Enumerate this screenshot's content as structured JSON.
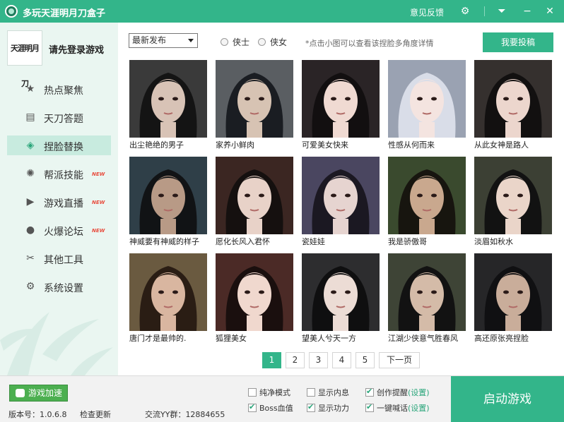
{
  "window": {
    "title": "多玩天涯明月刀盒子",
    "feedback": "意见反馈",
    "settings_icon": "⚙",
    "dropdown_icon": "⏷",
    "minimize_icon": "−",
    "close_icon": "✕"
  },
  "sidebar": {
    "avatar_text": "天涯明月刀",
    "login_label": "请先登录游戏",
    "items": [
      {
        "label": "热点聚焦",
        "icon": "★",
        "new": ""
      },
      {
        "label": "天刀答题",
        "icon": "▤",
        "new": ""
      },
      {
        "label": "捏脸替换",
        "icon": "◈",
        "new": ""
      },
      {
        "label": "帮派技能",
        "icon": "✺",
        "new": "NEW"
      },
      {
        "label": "游戏直播",
        "icon": "▶",
        "new": "NEW"
      },
      {
        "label": "火爆论坛",
        "icon": "●",
        "new": "NEW"
      },
      {
        "label": "其他工具",
        "icon": "✂",
        "new": ""
      },
      {
        "label": "系统设置",
        "icon": "⚙",
        "new": ""
      }
    ]
  },
  "toolbar": {
    "sort_value": "最新发布",
    "radio_male": "侠士",
    "radio_female": "侠女",
    "hint": "*点击小图可以查看该捏脸多角度详情",
    "submit_label": "我要投稿"
  },
  "faces": [
    {
      "caption": "出尘艳绝的男子",
      "bg": "#3a3a3a",
      "hair": "#141414",
      "skin": "#d8c3b6"
    },
    {
      "caption": "家养小鲜肉",
      "bg": "#5a5e62",
      "hair": "#1a1d22",
      "skin": "#d7c3b3"
    },
    {
      "caption": "可爱美女快来",
      "bg": "#2a2426",
      "hair": "#120f10",
      "skin": "#f0dad2"
    },
    {
      "caption": "性感从何而来",
      "bg": "#9aa2b2",
      "hair": "#d9dde8",
      "skin": "#f4e4e0"
    },
    {
      "caption": "从此女神是路人",
      "bg": "#35302e",
      "hair": "#121010",
      "skin": "#ecd6cd"
    },
    {
      "caption": "神威要有神威的样子",
      "bg": "#2f3f48",
      "hair": "#111315",
      "skin": "#b89a86"
    },
    {
      "caption": "愿化长风入君怀",
      "bg": "#3b2622",
      "hair": "#15100f",
      "skin": "#e8d2c8"
    },
    {
      "caption": "瓷娃娃",
      "bg": "#4a4660",
      "hair": "#1b1822",
      "skin": "#e6d4d0"
    },
    {
      "caption": "我是骄傲哥",
      "bg": "#3a4a2e",
      "hair": "#17150f",
      "skin": "#c9a88e"
    },
    {
      "caption": "淡眉如秋水",
      "bg": "#3c4034",
      "hair": "#121212",
      "skin": "#ead5c9"
    },
    {
      "caption": "唐门才是最帅的.",
      "bg": "#6a5a40",
      "hair": "#2a1d14",
      "skin": "#d9b6a0"
    },
    {
      "caption": "狐狸美女",
      "bg": "#4b2a26",
      "hair": "#1a0f0e",
      "skin": "#f0d8ce"
    },
    {
      "caption": "望美人兮天一方",
      "bg": "#2d2d2f",
      "hair": "#0f0f10",
      "skin": "#ecdcd5"
    },
    {
      "caption": "江湖少侠意气胜春风",
      "bg": "#3e4436",
      "hair": "#121212",
      "skin": "#d4bba8"
    },
    {
      "caption": "高还原张亮捏脸",
      "bg": "#262628",
      "hair": "#101012",
      "skin": "#c9ad9a"
    }
  ],
  "pager": {
    "pages": [
      "1",
      "2",
      "3",
      "4",
      "5"
    ],
    "active": 0,
    "next_label": "下一页"
  },
  "bottom": {
    "accel_label": "游戏加速",
    "version": "版本号：1.0.6.8",
    "check_update": "检查更新",
    "yy_group": "交流YY群：12884655",
    "options": [
      {
        "label": "纯净模式",
        "checked": false,
        "link": ""
      },
      {
        "label": "显示内息",
        "checked": false,
        "link": ""
      },
      {
        "label": "创作提醒",
        "checked": true,
        "link": "(设置)"
      },
      {
        "label": "Boss血值",
        "checked": true,
        "link": ""
      },
      {
        "label": "显示功力",
        "checked": true,
        "link": ""
      },
      {
        "label": "一键喊话",
        "checked": true,
        "link": "(设置)"
      }
    ],
    "launch_label": "启动游戏"
  },
  "colors": {
    "accent": "#33b58a",
    "sidebar_bg": "#eaf6f1",
    "active_nav": "#c8ebdf"
  }
}
